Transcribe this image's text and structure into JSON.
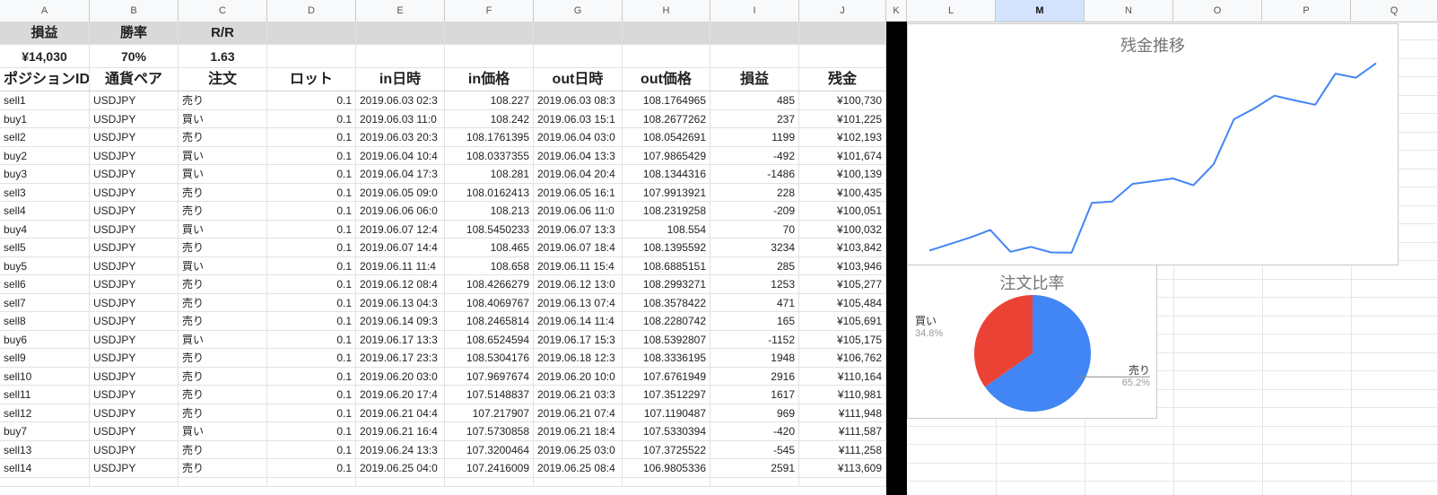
{
  "columns": [
    "A",
    "B",
    "C",
    "D",
    "E",
    "F",
    "G",
    "H",
    "I",
    "J",
    "K",
    "L",
    "M",
    "N",
    "O",
    "P",
    "Q"
  ],
  "selected_column": "M",
  "summary": {
    "headers": [
      "損益",
      "勝率",
      "R/R"
    ],
    "values": [
      "¥14,030",
      "70%",
      "1.63"
    ]
  },
  "table": {
    "headers": [
      "ポジションID",
      "通貨ペア",
      "注文",
      "ロット",
      "in日時",
      "in価格",
      "out日時",
      "out価格",
      "損益",
      "残金"
    ],
    "rows": [
      [
        "sell1",
        "USDJPY",
        "売り",
        "0.1",
        "2019.06.03 02:3",
        "108.227",
        "2019.06.03 08:3",
        "108.1764965",
        "485",
        "¥100,730"
      ],
      [
        "buy1",
        "USDJPY",
        "買い",
        "0.1",
        "2019.06.03 11:0",
        "108.242",
        "2019.06.03 15:1",
        "108.2677262",
        "237",
        "¥101,225"
      ],
      [
        "sell2",
        "USDJPY",
        "売り",
        "0.1",
        "2019.06.03 20:3",
        "108.1761395",
        "2019.06.04 03:0",
        "108.0542691",
        "1199",
        "¥102,193"
      ],
      [
        "buy2",
        "USDJPY",
        "買い",
        "0.1",
        "2019.06.04 10:4",
        "108.0337355",
        "2019.06.04 13:3",
        "107.9865429",
        "-492",
        "¥101,674"
      ],
      [
        "buy3",
        "USDJPY",
        "買い",
        "0.1",
        "2019.06.04 17:3",
        "108.281",
        "2019.06.04 20:4",
        "108.1344316",
        "-1486",
        "¥100,139"
      ],
      [
        "sell3",
        "USDJPY",
        "売り",
        "0.1",
        "2019.06.05 09:0",
        "108.0162413",
        "2019.06.05 16:1",
        "107.9913921",
        "228",
        "¥100,435"
      ],
      [
        "sell4",
        "USDJPY",
        "売り",
        "0.1",
        "2019.06.06 06:0",
        "108.213",
        "2019.06.06 11:0",
        "108.2319258",
        "-209",
        "¥100,051"
      ],
      [
        "buy4",
        "USDJPY",
        "買い",
        "0.1",
        "2019.06.07 12:4",
        "108.5450233",
        "2019.06.07 13:3",
        "108.554",
        "70",
        "¥100,032"
      ],
      [
        "sell5",
        "USDJPY",
        "売り",
        "0.1",
        "2019.06.07 14:4",
        "108.465",
        "2019.06.07 18:4",
        "108.1395592",
        "3234",
        "¥103,842"
      ],
      [
        "buy5",
        "USDJPY",
        "買い",
        "0.1",
        "2019.06.11 11:4",
        "108.658",
        "2019.06.11 15:4",
        "108.6885151",
        "285",
        "¥103,946"
      ],
      [
        "sell6",
        "USDJPY",
        "売り",
        "0.1",
        "2019.06.12 08:4",
        "108.4266279",
        "2019.06.12 13:0",
        "108.2993271",
        "1253",
        "¥105,277"
      ],
      [
        "sell7",
        "USDJPY",
        "売り",
        "0.1",
        "2019.06.13 04:3",
        "108.4069767",
        "2019.06.13 07:4",
        "108.3578422",
        "471",
        "¥105,484"
      ],
      [
        "sell8",
        "USDJPY",
        "売り",
        "0.1",
        "2019.06.14 09:3",
        "108.2465814",
        "2019.06.14 11:4",
        "108.2280742",
        "165",
        "¥105,691"
      ],
      [
        "buy6",
        "USDJPY",
        "買い",
        "0.1",
        "2019.06.17 13:3",
        "108.6524594",
        "2019.06.17 15:3",
        "108.5392807",
        "-1152",
        "¥105,175"
      ],
      [
        "sell9",
        "USDJPY",
        "売り",
        "0.1",
        "2019.06.17 23:3",
        "108.5304176",
        "2019.06.18 12:3",
        "108.3336195",
        "1948",
        "¥106,762"
      ],
      [
        "sell10",
        "USDJPY",
        "売り",
        "0.1",
        "2019.06.20 03:0",
        "107.9697674",
        "2019.06.20 10:0",
        "107.6761949",
        "2916",
        "¥110,164"
      ],
      [
        "sell11",
        "USDJPY",
        "売り",
        "0.1",
        "2019.06.20 17:4",
        "107.5148837",
        "2019.06.21 03:3",
        "107.3512297",
        "1617",
        "¥110,981"
      ],
      [
        "sell12",
        "USDJPY",
        "売り",
        "0.1",
        "2019.06.21 04:4",
        "107.217907",
        "2019.06.21 07:4",
        "107.1190487",
        "969",
        "¥111,948"
      ],
      [
        "buy7",
        "USDJPY",
        "買い",
        "0.1",
        "2019.06.21 16:4",
        "107.5730858",
        "2019.06.21 18:4",
        "107.5330394",
        "-420",
        "¥111,587"
      ],
      [
        "sell13",
        "USDJPY",
        "売り",
        "0.1",
        "2019.06.24 13:3",
        "107.3200464",
        "2019.06.25 03:0",
        "107.3725522",
        "-545",
        "¥111,258"
      ],
      [
        "sell14",
        "USDJPY",
        "売り",
        "0.1",
        "2019.06.25 04:0",
        "107.2416009",
        "2019.06.25 08:4",
        "106.9805336",
        "2591",
        "¥113,609"
      ]
    ]
  },
  "colors": {
    "line": "#4285f4",
    "buy": "#ea4335",
    "sell": "#4285f4",
    "header_bg": "#d9d9d9",
    "selected_col": "#d3e3fd"
  },
  "chart_data": [
    {
      "type": "line",
      "title": "残金推移",
      "xlabel": "",
      "ylabel": "",
      "grid": false,
      "series": [
        {
          "values": [
            100245,
            100730,
            101225,
            101800,
            100150,
            100520,
            100100,
            100080,
            103840,
            103946,
            105277,
            105484,
            105691,
            105175,
            106762,
            110164,
            110981,
            111948,
            111587,
            111258,
            113609,
            113300,
            114400
          ]
        }
      ]
    },
    {
      "type": "pie",
      "title": "注文比率",
      "slices": [
        {
          "label": "売り",
          "value": 65.2,
          "pct_label": "65.2%"
        },
        {
          "label": "買い",
          "value": 34.8,
          "pct_label": "34.8%"
        }
      ]
    }
  ]
}
